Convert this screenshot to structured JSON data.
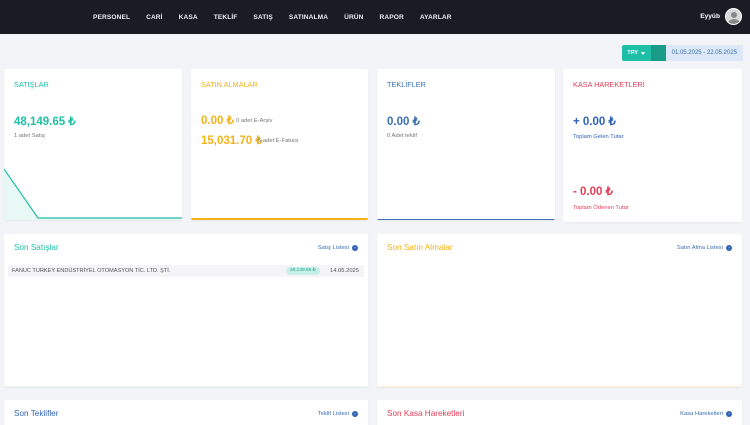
{
  "nav": {
    "items": [
      "PERSONEL",
      "CARİ",
      "KASA",
      "TEKLİF",
      "SATIŞ",
      "SATINALMA",
      "ÜRÜN",
      "RAPOR",
      "AYARLAR"
    ]
  },
  "user": {
    "name": "Eyyüb",
    "icon": "avatar"
  },
  "filter": {
    "currency": "TRY",
    "date_range": "01.05.2025 - 22.05.2025"
  },
  "cards": {
    "satislar": {
      "title": "SATIŞLAR",
      "amount": "48,149.65 ₺",
      "count_text": "1 adet Satış",
      "color": "#1fbfa7"
    },
    "satinalmalar": {
      "title": "SATIN ALMALAR",
      "amount1": "0.00 ₺",
      "note1": "0 adet E-Arşiv",
      "amount2": "15,031.70 ₺",
      "note2": "6 adet E-Fatura",
      "color": "#f4b21a"
    },
    "teklifler": {
      "title": "TEKLİFLER",
      "amount": "0.00 ₺",
      "count_text": "0 Adet teklif",
      "color": "#3a6fb0"
    },
    "kasa": {
      "title": "KASA HAREKETLERİ",
      "income": "+ 0.00 ₺",
      "income_label": "Toplam Gelen Tutar",
      "expense": "- 0.00 ₺",
      "expense_label": "Toplam Ödenen Tutar",
      "color": "#e23d56"
    }
  },
  "panels": {
    "son_satislar": {
      "title": "Son Satışlar",
      "link": "Satış Listesi",
      "rows": [
        {
          "name": "FANUC TURKEY ENDÜSTRİYEL OTOMASYON TİC. LTD. ŞTİ.",
          "amount": "48,149.65 ₺",
          "date": "14.05.2025"
        }
      ]
    },
    "son_satin_almalar": {
      "title": "Son Satın Almalar",
      "link": "Satın Alma Listesi"
    },
    "son_teklifler": {
      "title": "Son Teklifler",
      "link": "Teklif Listesi"
    },
    "son_kasa": {
      "title": "Son Kasa Hareketleri",
      "link": "Kasa Hareketleri"
    }
  }
}
